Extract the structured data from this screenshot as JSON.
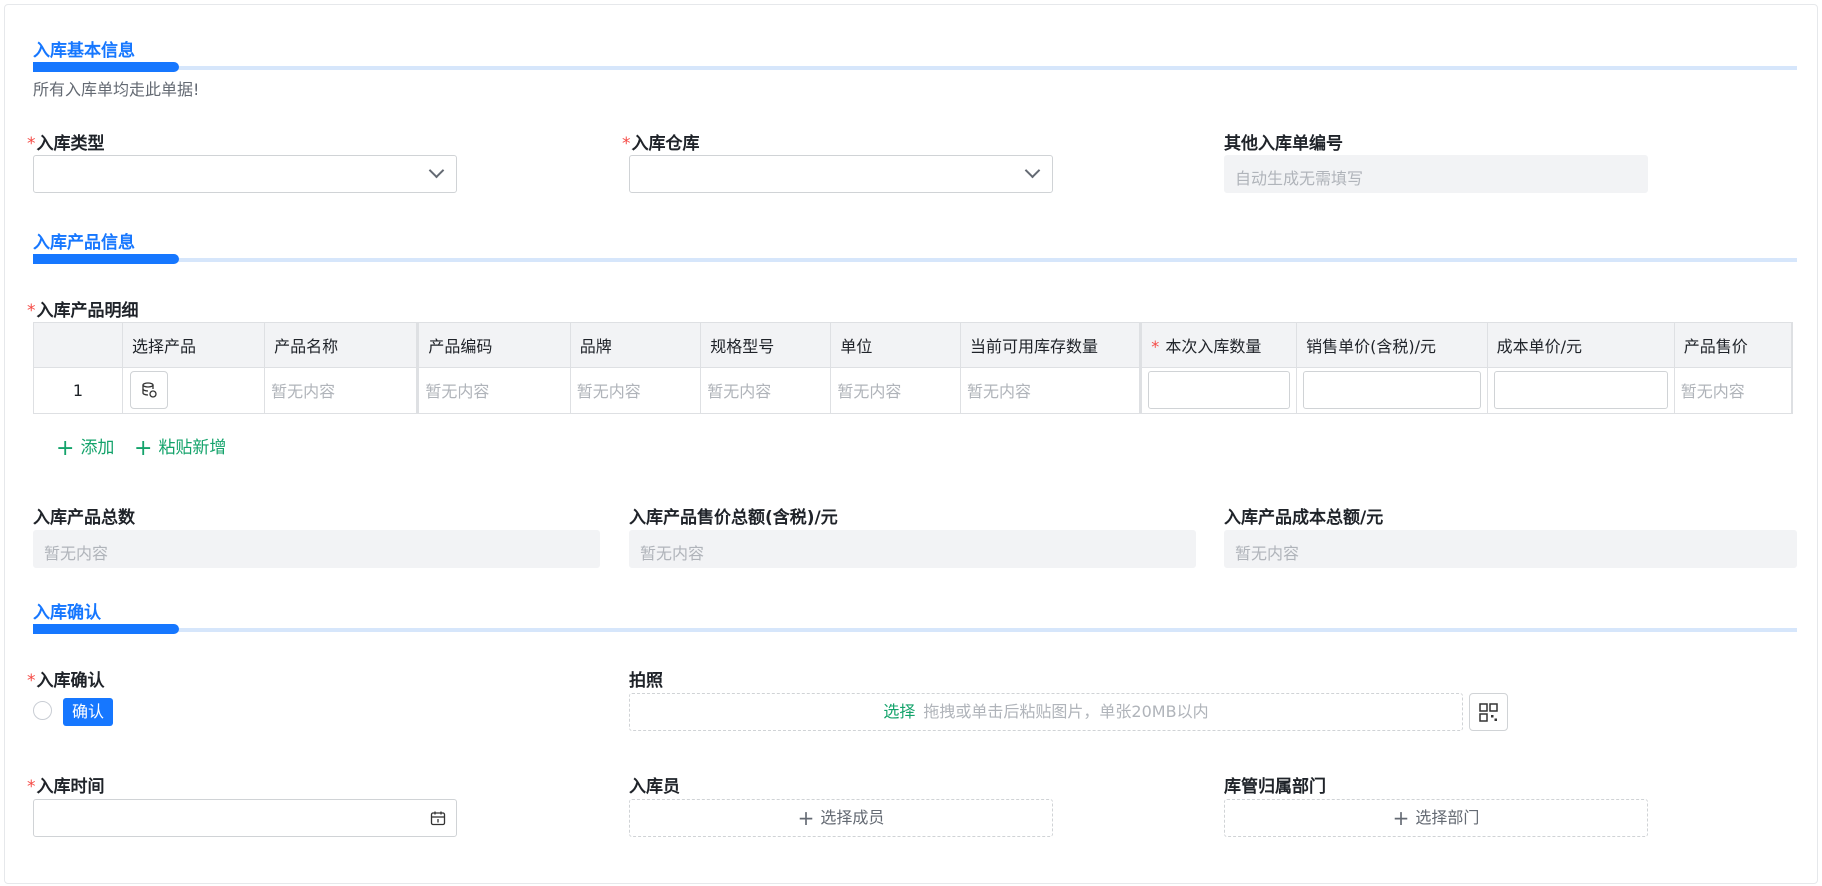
{
  "section_basic": {
    "title": "入库基本信息",
    "note": "所有入库单均走此单据!"
  },
  "fields_basic": {
    "type_label": "入库类型",
    "warehouse_label": "入库仓库",
    "order_no_label": "其他入库单编号",
    "order_no_placeholder": "自动生成无需填写"
  },
  "section_products": {
    "title": "入库产品信息",
    "detail_label": "入库产品明细",
    "columns": [
      "选择产品",
      "产品名称",
      "产品编码",
      "品牌",
      "规格型号",
      "单位",
      "当前可用库存数量",
      "本次入库数量",
      "销售单价(含税)/元",
      "成本单价/元",
      "产品售价"
    ],
    "row": {
      "index": "1",
      "empty": "暂无内容"
    },
    "add_label": "添加",
    "paste_add_label": "粘贴新增"
  },
  "totals": {
    "count_label": "入库产品总数",
    "sale_total_label": "入库产品售价总额(含税)/元",
    "cost_total_label": "入库产品成本总额/元",
    "empty": "暂无内容"
  },
  "section_confirm": {
    "title": "入库确认",
    "confirm_label": "入库确认",
    "confirm_tag": "确认",
    "photo_label": "拍照",
    "upload_select": "选择",
    "upload_hint": "拖拽或单击后粘贴图片，单张20MB以内",
    "time_label": "入库时间",
    "staff_label": "入库员",
    "staff_button": "选择成员",
    "dept_label": "库管归属部门",
    "dept_button": "选择部门"
  },
  "colors": {
    "accent": "#1677ff",
    "required": "#f54a45",
    "link_green": "#14a36b"
  }
}
